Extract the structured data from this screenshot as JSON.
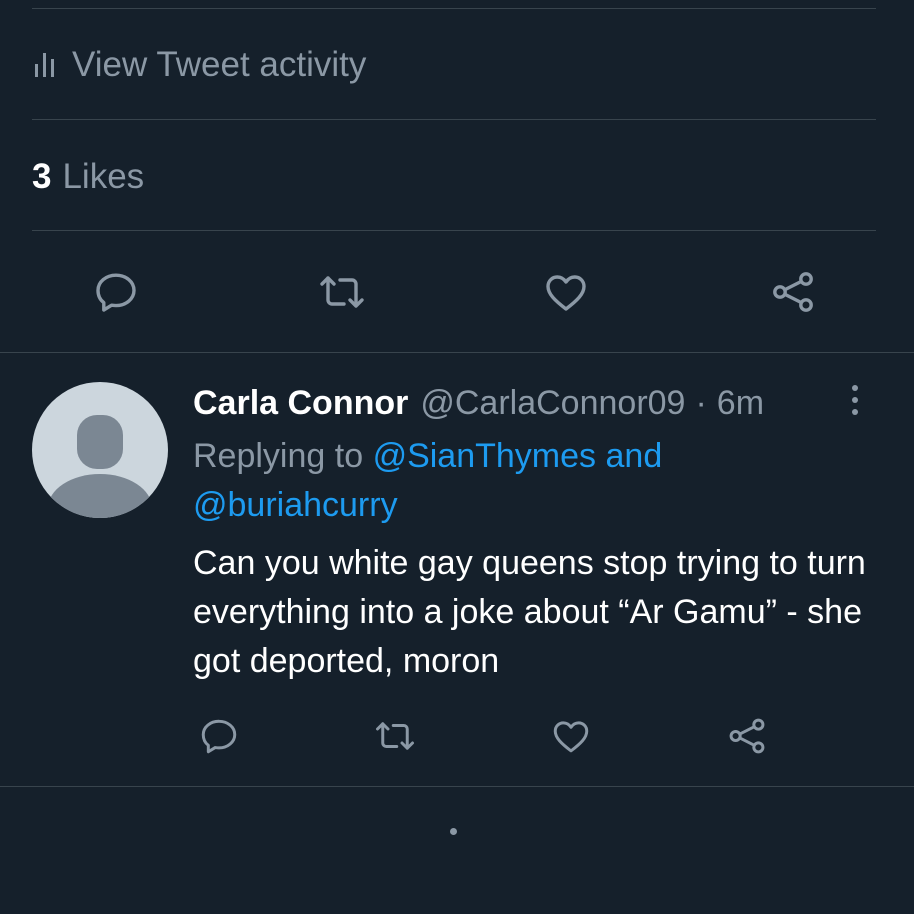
{
  "tweet_activity": {
    "label": "View Tweet activity",
    "icon": "bar-chart-icon"
  },
  "likes": {
    "count": "3",
    "label": "Likes"
  },
  "actions": {
    "reply": "reply-icon",
    "retweet": "retweet-icon",
    "like": "heart-icon",
    "share": "share-icon"
  },
  "reply": {
    "author_name": "Carla Connor",
    "author_handle": "@CarlaConnor09",
    "separator": "·",
    "time": "6m",
    "replying_prefix": "Replying to",
    "mention_1": "@SianThymes",
    "mention_joiner": "and",
    "mention_2": "@buriahcurry",
    "text": "Can you white gay queens stop trying to turn everything into a joke about “Ar Gamu” - she got deported, moron"
  },
  "colors": {
    "background": "#15202b",
    "divider": "#38444d",
    "secondary_text": "#8b98a5",
    "accent": "#1d9bf0",
    "avatar_bg": "#ccd6dd",
    "avatar_figure": "#7b8793"
  }
}
